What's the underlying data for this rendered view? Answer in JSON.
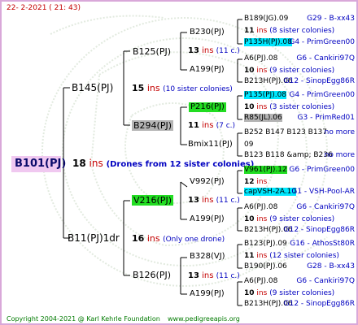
{
  "header": "22-  2-2021 (  21: 43)",
  "footer": {
    "copyright": "Copyright 2004-2021 @ Karl Kehrle Foundation",
    "site": "www.pedigreeapis.org"
  },
  "colors": {
    "border": "#d9a8d9",
    "ins": "#c40000",
    "note": "#0000c0",
    "green": "#22dd22",
    "cyan": "#00e8ff",
    "gray": "#b4b4b4",
    "root_bg": "#f0c8f0"
  },
  "root": {
    "label": "B101(PJ)",
    "count": "18",
    "ins": "ins",
    "note": "(Drones from 12 sister colonies)"
  },
  "gen1": [
    {
      "label": "B145(PJ)",
      "count": "15",
      "ins": "ins",
      "note": "(10 sister colonies)"
    },
    {
      "label": "B11(PJ)1dr",
      "count": "16",
      "ins": "ins",
      "note": "(Only one drone)"
    }
  ],
  "gen2": [
    {
      "label": "B125(PJ)",
      "count": "13",
      "ins": "ins",
      "note": "(11 c.)"
    },
    {
      "label": "B294(PJ)",
      "count": "11",
      "ins": "ins",
      "note": "(7 c.)"
    },
    {
      "label": "V216(PJ)",
      "count": "13",
      "ins": "ins",
      "note": "(11 c.)"
    },
    {
      "label": "B126(PJ)",
      "count": "13",
      "ins": "ins",
      "note": "(11 c.)"
    }
  ],
  "gen3": [
    {
      "label": "B230(PJ)",
      "count": "13",
      "ins": "ins",
      "note": "(11 c.)"
    },
    {
      "label": "A199(PJ)"
    },
    {
      "label": "P216(PJ)",
      "count": "11",
      "ins": "ins",
      "note": "(7 c.)"
    },
    {
      "label": "Bmix11(PJ)"
    },
    {
      "label": "V992(PJ)",
      "count": "13",
      "ins": "ins",
      "note": "(11 c.)"
    },
    {
      "label": "A199(PJ)"
    },
    {
      "label": "B328(VJ)",
      "count": "13",
      "ins": "ins",
      "note": "(11 c.)"
    },
    {
      "label": "A199(PJ)"
    }
  ],
  "gen4": [
    {
      "label": "B189(JG).09",
      "right": "G29 - B-xx43"
    },
    {
      "label": "11",
      "ins": "ins",
      "note": "(8 sister colonies)"
    },
    {
      "label": "P135H(PJ).08",
      "right": "G4 - PrimGreen00"
    },
    {
      "label": "A6(PJ).08",
      "right": "G6 - Cankiri97Q"
    },
    {
      "label": "10",
      "ins": "ins",
      "note": "(9 sister colonies)"
    },
    {
      "label": "B213H(PJ).06",
      "right": "G12 - SinopEgg86R"
    },
    {
      "label": "P135(PJ).08",
      "right": "G4 - PrimGreen00"
    },
    {
      "label": "10",
      "ins": "ins",
      "note": "(3 sister colonies)"
    },
    {
      "label": "R85(JL).06",
      "right": "G3 - PrimRed01"
    },
    {
      "label": "B252 B147 B123 B137",
      "right": "no more"
    },
    {
      "label": "09"
    },
    {
      "label": "B123 B118 &amp; B236",
      "right": "no more"
    },
    {
      "label": "V961(PJ).12",
      "right": "G6 - PrimGreen00"
    },
    {
      "label": "12",
      "ins": "ins"
    },
    {
      "label": "capVSH-2A.10",
      "right": "G1 - VSH-Pool-AR"
    },
    {
      "label": "A6(PJ).08",
      "right": "G6 - Cankiri97Q"
    },
    {
      "label": "10",
      "ins": "ins",
      "note": "(9 sister colonies)"
    },
    {
      "label": "B213H(PJ).06",
      "right": "G12 - SinopEgg86R"
    },
    {
      "label": "B123(PJ).09",
      "right": "G16 - AthosSt80R"
    },
    {
      "label": "11",
      "ins": "ins",
      "note": "(12 sister colonies)"
    },
    {
      "label": "B190(PJ).06",
      "right": "G28 - B-xx43"
    },
    {
      "label": "A6(PJ).08",
      "right": "G6 - Cankiri97Q"
    },
    {
      "label": "10",
      "ins": "ins",
      "note": "(9 sister colonies)"
    },
    {
      "label": "B213H(PJ).06",
      "right": "G12 - SinopEgg86R"
    }
  ]
}
